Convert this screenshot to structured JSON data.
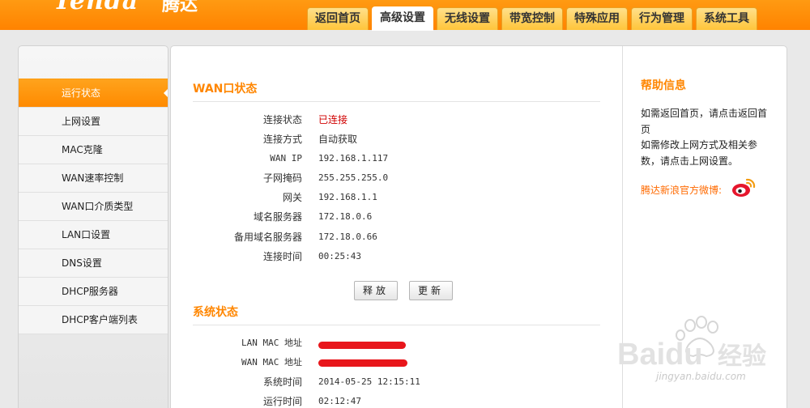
{
  "header": {
    "logo": "Tenda",
    "logo_cn": "腾达",
    "tabs": [
      "返回首页",
      "高级设置",
      "无线设置",
      "带宽控制",
      "特殊应用",
      "行为管理",
      "系统工具"
    ],
    "active_tab": 1,
    "accent_color": "#ff8a00"
  },
  "sidebar": {
    "items": [
      "运行状态",
      "上网设置",
      "MAC克隆",
      "WAN速率控制",
      "WAN口介质类型",
      "LAN口设置",
      "DNS设置",
      "DHCP服务器",
      "DHCP客户端列表"
    ],
    "active_item": 0
  },
  "wan": {
    "title": "WAN口状态",
    "rows": [
      {
        "label": "连接状态",
        "value": "已连接"
      },
      {
        "label": "连接方式",
        "value": "自动获取"
      },
      {
        "label": "WAN IP",
        "value": "192.168.1.117"
      },
      {
        "label": "子网掩码",
        "value": "255.255.255.0"
      },
      {
        "label": "网关",
        "value": "192.168.1.1"
      },
      {
        "label": "域名服务器",
        "value": "172.18.0.6"
      },
      {
        "label": "备用域名服务器",
        "value": "172.18.0.66"
      },
      {
        "label": "连接时间",
        "value": "00:25:43"
      }
    ],
    "release_button": "释放",
    "renew_button": "更新"
  },
  "system": {
    "title": "系统状态",
    "rows": [
      {
        "label": "LAN MAC 地址",
        "value": ""
      },
      {
        "label": "WAN MAC 地址",
        "value": ""
      },
      {
        "label": "系统时间",
        "value": "2014-05-25 12:15:11"
      },
      {
        "label": "运行时间",
        "value": "02:12:47"
      }
    ]
  },
  "help": {
    "title": "帮助信息",
    "text_1": "如需返回首页，请点击返回首页",
    "text_2": "如需修改上网方式及相关参数，请点击上网设置。",
    "link": "腾达新浪官方微博:",
    "icon": "weibo-icon"
  },
  "watermark": {
    "brand": "Baidu",
    "brand_cn": "经验",
    "url": "jingyan.baidu.com"
  }
}
